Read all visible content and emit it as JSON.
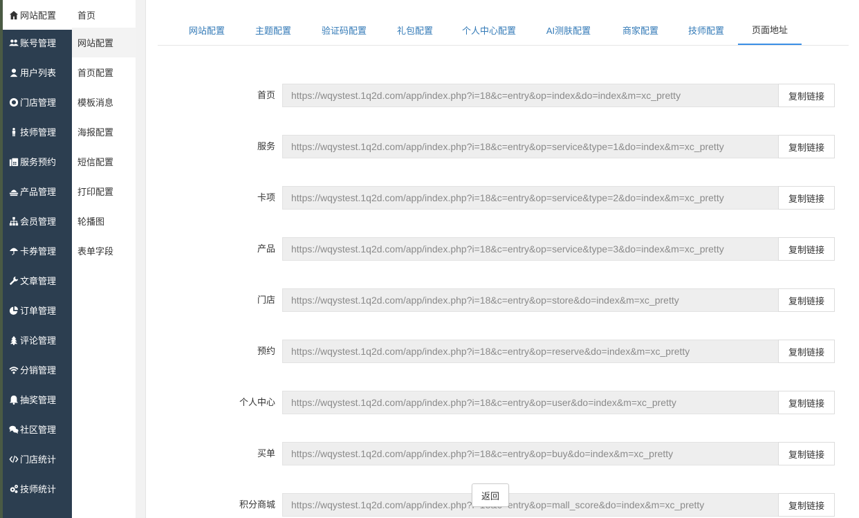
{
  "sidebar": {
    "items": [
      {
        "label": "网站配置",
        "icon": "home-icon",
        "active": true
      },
      {
        "label": "账号管理",
        "icon": "users-icon"
      },
      {
        "label": "用户列表",
        "icon": "user-icon"
      },
      {
        "label": "门店管理",
        "icon": "lifebuoy-icon"
      },
      {
        "label": "技师管理",
        "icon": "person-icon"
      },
      {
        "label": "服务预约",
        "icon": "fax-icon"
      },
      {
        "label": "产品管理",
        "icon": "product-icon"
      },
      {
        "label": "会员管理",
        "icon": "sitemap-icon"
      },
      {
        "label": "卡券管理",
        "icon": "umbrella-icon"
      },
      {
        "label": "文章管理",
        "icon": "wrench-icon"
      },
      {
        "label": "订单管理",
        "icon": "pie-chart-icon"
      },
      {
        "label": "评论管理",
        "icon": "tree-icon"
      },
      {
        "label": "分销管理",
        "icon": "wifi-icon"
      },
      {
        "label": "抽奖管理",
        "icon": "bell-icon"
      },
      {
        "label": "社区管理",
        "icon": "comments-icon"
      },
      {
        "label": "门店统计",
        "icon": "code-icon"
      },
      {
        "label": "技师统计",
        "icon": "gears-icon"
      }
    ]
  },
  "submenu": {
    "items": [
      {
        "label": "首页"
      },
      {
        "label": "网站配置",
        "active": true
      },
      {
        "label": "首页配置"
      },
      {
        "label": "模板消息"
      },
      {
        "label": "海报配置"
      },
      {
        "label": "短信配置"
      },
      {
        "label": "打印配置"
      },
      {
        "label": "轮播图"
      },
      {
        "label": "表单字段"
      }
    ]
  },
  "tabs": [
    {
      "label": "网站配置"
    },
    {
      "label": "主题配置"
    },
    {
      "label": "验证码配置"
    },
    {
      "label": "礼包配置"
    },
    {
      "label": "个人中心配置"
    },
    {
      "label": "AI测肤配置"
    },
    {
      "label": "商家配置"
    },
    {
      "label": "技师配置"
    },
    {
      "label": "页面地址",
      "active": true
    }
  ],
  "rows": [
    {
      "label": "首页",
      "url": "https://wqystest.1q2d.com/app/index.php?i=18&c=entry&op=index&do=index&m=xc_pretty",
      "copy": "复制链接"
    },
    {
      "label": "服务",
      "url": "https://wqystest.1q2d.com/app/index.php?i=18&c=entry&op=service&type=1&do=index&m=xc_pretty",
      "copy": "复制链接"
    },
    {
      "label": "卡项",
      "url": "https://wqystest.1q2d.com/app/index.php?i=18&c=entry&op=service&type=2&do=index&m=xc_pretty",
      "copy": "复制链接"
    },
    {
      "label": "产品",
      "url": "https://wqystest.1q2d.com/app/index.php?i=18&c=entry&op=service&type=3&do=index&m=xc_pretty",
      "copy": "复制链接"
    },
    {
      "label": "门店",
      "url": "https://wqystest.1q2d.com/app/index.php?i=18&c=entry&op=store&do=index&m=xc_pretty",
      "copy": "复制链接"
    },
    {
      "label": "预约",
      "url": "https://wqystest.1q2d.com/app/index.php?i=18&c=entry&op=reserve&do=index&m=xc_pretty",
      "copy": "复制链接"
    },
    {
      "label": "个人中心",
      "url": "https://wqystest.1q2d.com/app/index.php?i=18&c=entry&op=user&do=index&m=xc_pretty",
      "copy": "复制链接"
    },
    {
      "label": "买单",
      "url": "https://wqystest.1q2d.com/app/index.php?i=18&c=entry&op=buy&do=index&m=xc_pretty",
      "copy": "复制链接"
    },
    {
      "label": "积分商城",
      "url": "https://wqystest.1q2d.com/app/index.php?i=18&c=entry&op=mall_score&do=index&m=xc_pretty",
      "copy": "复制链接"
    }
  ],
  "back_button": "返回",
  "colors": {
    "sidebar_bg": "#2c3e50",
    "tab_link": "#337ab7",
    "tab_active_border": "#3a8ee6"
  }
}
